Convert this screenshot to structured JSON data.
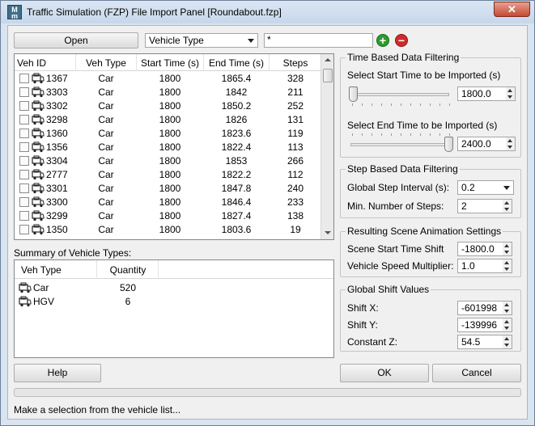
{
  "window": {
    "title": "Traffic Simulation (FZP) File Import Panel [Roundabout.fzp]",
    "icon_text_top": "M",
    "icon_text_bottom": "m",
    "close_glyph": "✕"
  },
  "toolbar": {
    "open_label": "Open",
    "filter_field": "Vehicle Type",
    "filter_value": "*",
    "add_glyph": "+",
    "remove_glyph": "−"
  },
  "vehicle_list": {
    "headers": [
      "Veh ID",
      "Veh Type",
      "Start Time (s)",
      "End Time (s)",
      "Steps"
    ],
    "rows": [
      {
        "id": "1367",
        "type": "Car",
        "start": "1800",
        "end": "1865.4",
        "steps": "328"
      },
      {
        "id": "3303",
        "type": "Car",
        "start": "1800",
        "end": "1842",
        "steps": "211"
      },
      {
        "id": "3302",
        "type": "Car",
        "start": "1800",
        "end": "1850.2",
        "steps": "252"
      },
      {
        "id": "3298",
        "type": "Car",
        "start": "1800",
        "end": "1826",
        "steps": "131"
      },
      {
        "id": "1360",
        "type": "Car",
        "start": "1800",
        "end": "1823.6",
        "steps": "119"
      },
      {
        "id": "1356",
        "type": "Car",
        "start": "1800",
        "end": "1822.4",
        "steps": "113"
      },
      {
        "id": "3304",
        "type": "Car",
        "start": "1800",
        "end": "1853",
        "steps": "266"
      },
      {
        "id": "2777",
        "type": "Car",
        "start": "1800",
        "end": "1822.2",
        "steps": "112"
      },
      {
        "id": "3301",
        "type": "Car",
        "start": "1800",
        "end": "1847.8",
        "steps": "240"
      },
      {
        "id": "3300",
        "type": "Car",
        "start": "1800",
        "end": "1846.4",
        "steps": "233"
      },
      {
        "id": "3299",
        "type": "Car",
        "start": "1800",
        "end": "1827.4",
        "steps": "138"
      },
      {
        "id": "1350",
        "type": "Car",
        "start": "1800",
        "end": "1803.6",
        "steps": "19"
      }
    ]
  },
  "summary": {
    "label": "Summary of Vehicle Types:",
    "headers": [
      "Veh Type",
      "Quantity"
    ],
    "rows": [
      {
        "type": "Car",
        "quantity": "520"
      },
      {
        "type": "HGV",
        "quantity": "6"
      }
    ]
  },
  "time_filter": {
    "title": "Time Based Data Filtering",
    "start_label": "Select Start Time to be Imported (s)",
    "start_value": "1800.0",
    "start_slider_level": 0.0,
    "end_label": "Select End Time to be Imported (s)",
    "end_value": "2400.0",
    "end_slider_level": 1.0
  },
  "step_filter": {
    "title": "Step Based Data Filtering",
    "interval_label": "Global Step Interval (s):",
    "interval_value": "0.2",
    "min_steps_label": "Min. Number of Steps:",
    "min_steps_value": "2"
  },
  "animation": {
    "title": "Resulting Scene Animation Settings",
    "shift_label": "Scene Start Time Shift",
    "shift_value": "-1800.0",
    "speed_label": "Vehicle Speed Multiplier:",
    "speed_value": "1.0"
  },
  "global_shift": {
    "title": "Global Shift Values",
    "x_label": "Shift X:",
    "x_value": "-601998",
    "y_label": "Shift Y:",
    "y_value": "-139996",
    "z_label": "Constant Z:",
    "z_value": "54.5"
  },
  "footer": {
    "help_label": "Help",
    "ok_label": "OK",
    "cancel_label": "Cancel",
    "progress": 0.0,
    "status": "Make a selection from the vehicle list..."
  },
  "icons": {
    "vehicle": "vehicle-icon",
    "add": "plus-circle-icon",
    "remove": "minus-circle-icon"
  },
  "colors": {
    "add_green": "#2e9b2e",
    "remove_red": "#d12a2a",
    "close_red": "#c44b34"
  }
}
